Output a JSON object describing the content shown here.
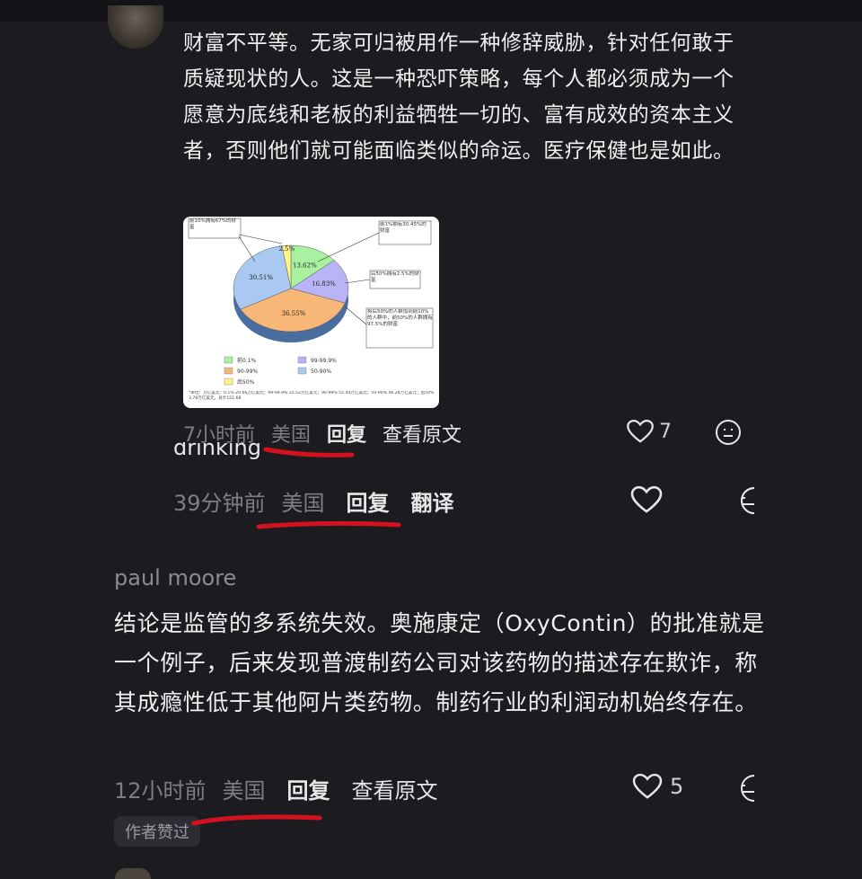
{
  "comment1": {
    "text": "财富不平等。无家可归被用作一种修辞威胁，针对任何敢于质疑现状的人。这是一种恐吓策略，每个人都必须成为一个愿意为底线和老板的利益牺牲一切的、富有成效的资本主义者，否则他们就可能面临类似的命运。医疗保健也是如此。",
    "time": "7小时前",
    "location": "美国",
    "reply": "回复",
    "view_original": "查看原文",
    "likes": "7"
  },
  "chart_data": {
    "type": "pie",
    "values": [
      13.62,
      16.83,
      36.55,
      30.51,
      2.5
    ],
    "labels": [
      "13.62%",
      "16.83%",
      "36.55%",
      "30.51%",
      "2.5%"
    ],
    "colors": [
      "#a9f0a0",
      "#b9b4f5",
      "#f7b777",
      "#a9c9f2",
      "#fff38a"
    ],
    "legend": [
      "前0.1%",
      "99-99.9%",
      "90-99%",
      "50-90%",
      "后50%"
    ],
    "legend_colors": [
      "#a9f0a0",
      "#b9b4f5",
      "#f7b777",
      "#a9c9f2",
      "#fff38a"
    ],
    "annotations": [
      "前10%拥有67%的财富",
      "前1%拥有30.45%的财富",
      "后50%拥有2.5%的财富",
      "将后50%的人群加到前10%的人群中，前50%的人群拥有97.5%的财富"
    ],
    "footnote": "*单位：万亿美元：0.1% 20.66万亿美元；99-99.9% 25.52万亿美元；90-99% 55.44万亿美元；50-90% 46.28万亿美元；后50% 3.78万亿美元，总计151.68"
  },
  "comment2": {
    "partial_text": "drinking",
    "time": "39分钟前",
    "location": "美国",
    "reply": "回复",
    "translate": "翻译"
  },
  "comment3": {
    "username": "paul moore",
    "text": "结论是监管的多系统失效。奥施康定（OxyContin）的批准就是一个例子，后来发现普渡制药公司对该药物的描述存在欺诈，称其成瘾性低于其他阿片类药物。制药行业的利润动机始终存在。",
    "time": "12小时前",
    "location": "美国",
    "reply": "回复",
    "view_original": "查看原文",
    "likes": "5",
    "badge": "作者赞过"
  },
  "colors": {
    "background": "#1c1b20",
    "annotation_red": "#d4111e"
  },
  "icons": [
    "heart-icon",
    "emoji-icon"
  ]
}
